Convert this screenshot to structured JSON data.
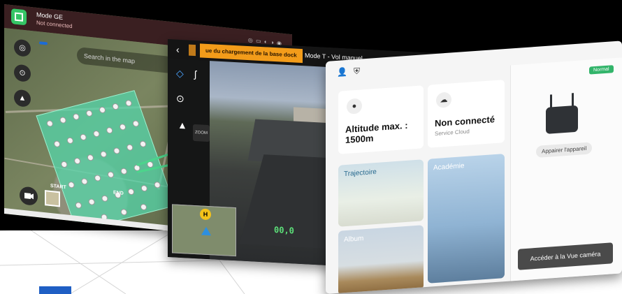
{
  "colors": {
    "accent_green": "#35c466",
    "warning_orange": "#f39c1a",
    "primary_blue": "#1c6bd6",
    "ok_green": "#32b46a",
    "hud_green": "#5ce079"
  },
  "screen_map": {
    "mode_label": "Mode GE",
    "connection_status": "Not connected",
    "badge": "",
    "search_placeholder": "Search in the map",
    "start_tag": "START",
    "end_tag": "END",
    "icons": [
      "locate-icon",
      "radar-icon",
      "compass-icon",
      "camera-icon"
    ]
  },
  "screen_camera": {
    "back_icon": "chevron-left-icon",
    "orange_banner": "ue du chargement de la base dock",
    "title": "Mode T - Vol manuel",
    "status": "",
    "zoom_label": "ZOOM",
    "hud_value": "00,0",
    "h_badge": "H"
  },
  "screen_home": {
    "altitude_card": {
      "title": "Altitude max. : 1500m",
      "sub": ""
    },
    "cloud_card": {
      "title": "Non connecté",
      "sub": "Service Cloud"
    },
    "tiles": {
      "trajectory": "Trajectoire",
      "academy": "Académie",
      "album": "Album"
    },
    "right_panel": {
      "status_badge": "Normal",
      "device_label": "",
      "pair_button": "Appairer l'appareil",
      "drone_label": "",
      "cta_button": "Accéder à la Vue caméra"
    }
  }
}
